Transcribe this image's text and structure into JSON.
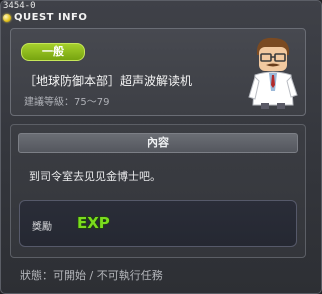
{
  "window": {
    "quest_id": "3454-0",
    "title": "QUEST INFO"
  },
  "quest": {
    "category": "一般",
    "name": "［地球防御本部］超声波解读机",
    "level": "建議等級：75～79",
    "npc_icon": "doctor-npc-icon"
  },
  "content": {
    "header": "內容",
    "text": "到司令室去见见金博士吧。"
  },
  "reward": {
    "label": "獎勵",
    "exp_text": "EXP",
    "exp_icon": "exp-reward-icon"
  },
  "status": {
    "text": "狀態：可開始 / 不可執行任務"
  },
  "colors": {
    "badge_green": "#8fbf1c",
    "exp_green": "#7bdc1e",
    "title_dot_yellow": "#e3c21a",
    "background": "#33353b"
  }
}
